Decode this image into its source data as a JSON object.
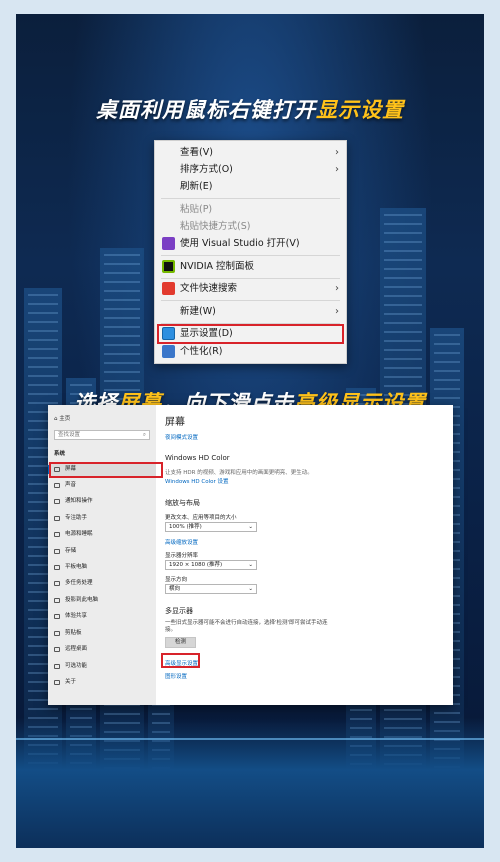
{
  "headline1": {
    "prefix": "桌面利用鼠标右键打开",
    "highlight": "显示设置"
  },
  "headline2": {
    "prefix": "选择",
    "h1": "屏幕",
    "mid": "，向下滑点击",
    "h2": "高级显示设置"
  },
  "colors": {
    "highlight": "#ffc21a",
    "redbox": "#d8232a",
    "link": "#0067c0"
  },
  "context_menu": {
    "items": [
      {
        "label": "查看(V)",
        "submenu": true
      },
      {
        "label": "排序方式(O)",
        "submenu": true
      },
      {
        "label": "刷新(E)"
      },
      {
        "label": "粘贴(P)",
        "disabled": true
      },
      {
        "label": "粘贴快捷方式(S)",
        "disabled": true
      },
      {
        "label": "使用 Visual Studio 打开(V)",
        "icon": "visual-studio-icon"
      },
      {
        "label": "NVIDIA 控制面板",
        "icon": "nvidia-icon"
      },
      {
        "label": "文件快速搜索",
        "icon": "wps-search-icon",
        "submenu": true
      },
      {
        "label": "新建(W)",
        "submenu": true
      },
      {
        "label": "显示设置(D)",
        "icon": "display-icon",
        "highlighted": true
      },
      {
        "label": "个性化(R)",
        "icon": "personalize-icon"
      }
    ],
    "chevron": "›"
  },
  "settings": {
    "home": "主页",
    "search_placeholder": "查找设置",
    "search_icon": "⌕",
    "category": "系统",
    "sidebar": [
      {
        "label": "屏幕",
        "active": true
      },
      {
        "label": "声音"
      },
      {
        "label": "通知和操作"
      },
      {
        "label": "专注助手"
      },
      {
        "label": "电源和睡眠"
      },
      {
        "label": "存储"
      },
      {
        "label": "平板电脑"
      },
      {
        "label": "多任务处理"
      },
      {
        "label": "投影到此电脑"
      },
      {
        "label": "体验共享"
      },
      {
        "label": "剪贴板"
      },
      {
        "label": "远程桌面"
      },
      {
        "label": "可选功能"
      },
      {
        "label": "关于"
      }
    ],
    "main": {
      "title": "屏幕",
      "night_link": "夜间模式设置",
      "hd_heading": "Windows HD Color",
      "hd_desc": "让支持 HDR 的视频、游戏和应用中的画面更明亮、更生动。",
      "hd_link": "Windows HD Color 设置",
      "scale_heading": "缩放与布局",
      "scale_label": "更改文本、应用等项目的大小",
      "scale_value": "100% (推荐)",
      "scale_link": "高级缩放设置",
      "res_label": "显示器分辨率",
      "res_value": "1920 × 1080 (推荐)",
      "orient_label": "显示方向",
      "orient_value": "横向",
      "multi_heading": "多显示器",
      "multi_desc": "一些旧式显示器可能不会进行自动连接，选择'检测'即可尝试手动连接。",
      "detect_button": "检测",
      "advanced_link": "高级显示设置",
      "graphics_link": "图形设置"
    }
  }
}
